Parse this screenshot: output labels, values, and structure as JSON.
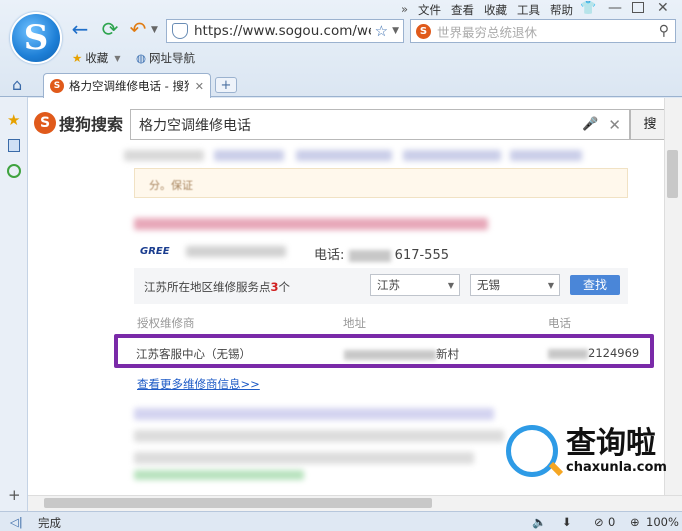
{
  "menu": [
    "文件",
    "查看",
    "收藏",
    "工具",
    "帮助"
  ],
  "address": {
    "url": "https://www.sogou.com/we"
  },
  "search_box": {
    "placeholder": "世界最穷总统退休"
  },
  "bookmarks": {
    "favorites": "收藏",
    "nav": "网址导航"
  },
  "tab": {
    "title": "格力空调维修电话 - 搜狗"
  },
  "sogou": {
    "logo_text": "搜狗搜索",
    "query": "格力空调维修电话",
    "search_button": "搜"
  },
  "result": {
    "brand_logo": "GREE",
    "phone_label": "电话:",
    "phone_suffix": "617-555",
    "filter_text_before": "江苏所在地区维修服务点",
    "filter_count": "3",
    "filter_text_after": "个",
    "province": "江苏",
    "city": "无锡",
    "find_button": "查找",
    "columns": [
      "授权维修商",
      "地址",
      "电话"
    ],
    "row": {
      "name": "江苏客服中心（无锡）",
      "address_suffix": "新村",
      "phone_suffix": "2124969"
    },
    "more_link": "查看更多维修商信息>>"
  },
  "status": {
    "text": "完成",
    "count": "0",
    "zoom": "100%"
  },
  "watermark": {
    "zh": "查询啦",
    "en": "chaxunla.com"
  }
}
